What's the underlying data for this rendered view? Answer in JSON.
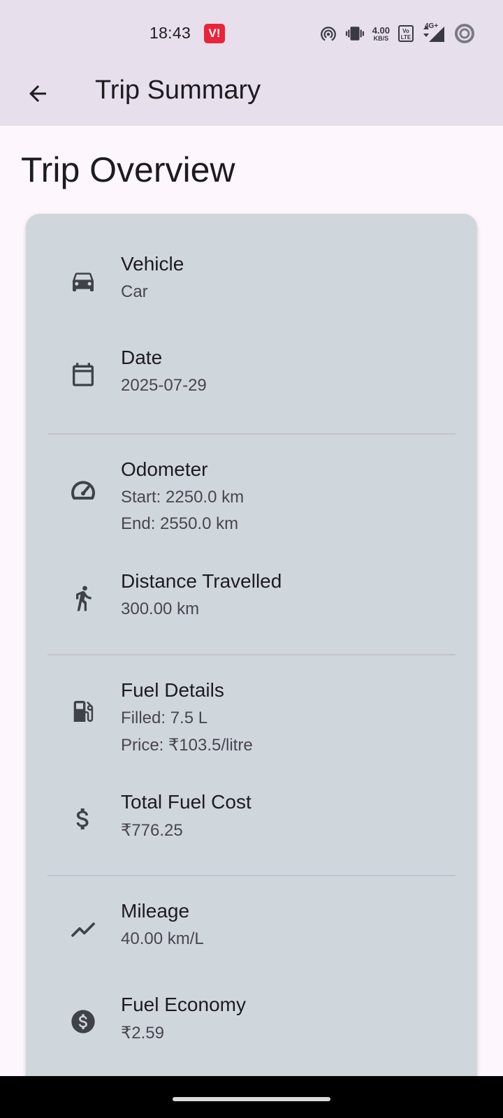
{
  "status_bar": {
    "time": "18:43",
    "carrier": "V!",
    "net_speed_value": "4.00",
    "net_speed_unit": "KB/S",
    "volte_top": "Vo",
    "volte_bottom": "LTE",
    "network": "4G+"
  },
  "app_bar": {
    "title": "Trip Summary",
    "back_icon": "arrow-back-icon"
  },
  "overview": {
    "heading": "Trip Overview",
    "items": [
      {
        "icon": "car-icon",
        "label": "Vehicle",
        "values": [
          "Car"
        ]
      },
      {
        "icon": "calendar-icon",
        "label": "Date",
        "values": [
          "2025-07-29"
        ]
      },
      {
        "icon": "speedometer-icon",
        "label": "Odometer",
        "values": [
          "Start: 2250.0 km",
          "End: 2550.0 km"
        ]
      },
      {
        "icon": "walking-person-icon",
        "label": "Distance Travelled",
        "values": [
          "300.00 km"
        ]
      },
      {
        "icon": "fuel-pump-icon",
        "label": "Fuel Details",
        "values": [
          "Filled: 7.5 L",
          "Price: ₹103.5/litre"
        ]
      },
      {
        "icon": "dollar-icon",
        "label": "Total Fuel Cost",
        "values": [
          "₹776.25"
        ]
      },
      {
        "icon": "trending-up-icon",
        "label": "Mileage",
        "values": [
          "40.00 km/L"
        ]
      },
      {
        "icon": "dollar-circle-icon",
        "label": "Fuel Economy",
        "values": [
          "₹2.59"
        ]
      }
    ]
  },
  "colors": {
    "app_bar_bg": "#e7e0ec",
    "page_bg": "#fdf7fd",
    "card_bg": "#cfd7dd",
    "icon_color": "#3f4249",
    "carrier_badge": "#e8253a"
  }
}
